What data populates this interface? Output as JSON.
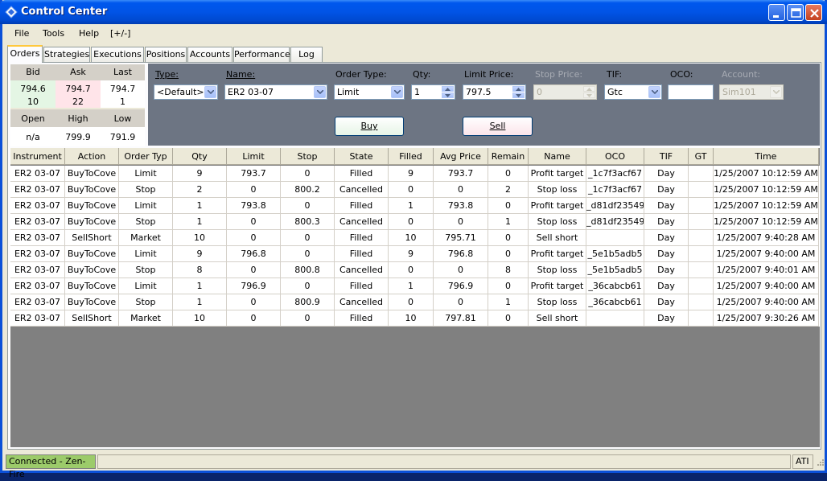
{
  "window": {
    "title": "Control Center"
  },
  "menu": {
    "file": "File",
    "tools": "Tools",
    "help": "Help",
    "toggle": "[+/-]"
  },
  "tabs": [
    "Orders",
    "Strategies",
    "Executions",
    "Positions",
    "Accounts",
    "Performance",
    "Log"
  ],
  "quote": {
    "bid_label": "Bid",
    "ask_label": "Ask",
    "last_label": "Last",
    "bid": "794.6",
    "ask": "794.7",
    "last": "794.7",
    "bid_size": "10",
    "ask_size": "22",
    "last_size": "1",
    "open_label": "Open",
    "high_label": "High",
    "low_label": "Low",
    "open": "n/a",
    "high": "799.9",
    "low": "791.9"
  },
  "entry": {
    "type_label": "Type:",
    "type_value": "<Default>",
    "name_label": "Name:",
    "name_value": "ER2 03-07",
    "order_type_label": "Order Type:",
    "order_type_value": "Limit",
    "qty_label": "Qty:",
    "qty_value": "1",
    "limit_label": "Limit Price:",
    "limit_value": "797.5",
    "stop_label": "Stop Price:",
    "stop_value": "0",
    "tif_label": "TIF:",
    "tif_value": "Gtc",
    "oco_label": "OCO:",
    "oco_value": "",
    "account_label": "Account:",
    "account_value": "Sim101",
    "buy_label": "Buy",
    "sell_label": "Sell"
  },
  "grid": {
    "columns": [
      "Instrument",
      "Action",
      "Order Typ",
      "Qty",
      "Limit",
      "Stop",
      "State",
      "Filled",
      "Avg Price",
      "Remain",
      "Name",
      "OCO",
      "TIF",
      "GT",
      "Time"
    ],
    "rows": [
      [
        "ER2 03-07",
        "BuyToCove",
        "Limit",
        "9",
        "793.7",
        "0",
        "Filled",
        "9",
        "793.7",
        "0",
        "Profit target",
        "_1c7f3acf67",
        "Day",
        "",
        "1/25/2007 10:12:59 AM"
      ],
      [
        "ER2 03-07",
        "BuyToCove",
        "Stop",
        "2",
        "0",
        "800.2",
        "Cancelled",
        "0",
        "0",
        "2",
        "Stop loss",
        "_1c7f3acf67",
        "Day",
        "",
        "1/25/2007 10:12:59 AM"
      ],
      [
        "ER2 03-07",
        "BuyToCove",
        "Limit",
        "1",
        "793.8",
        "0",
        "Filled",
        "1",
        "793.8",
        "0",
        "Profit target",
        "_d81df23549",
        "Day",
        "",
        "1/25/2007 10:12:59 AM"
      ],
      [
        "ER2 03-07",
        "BuyToCove",
        "Stop",
        "1",
        "0",
        "800.3",
        "Cancelled",
        "0",
        "0",
        "1",
        "Stop loss",
        "_d81df23549",
        "Day",
        "",
        "1/25/2007 10:12:59 AM"
      ],
      [
        "ER2 03-07",
        "SellShort",
        "Market",
        "10",
        "0",
        "0",
        "Filled",
        "10",
        "795.71",
        "0",
        "Sell short",
        "",
        "Day",
        "",
        "1/25/2007 9:40:28 AM"
      ],
      [
        "ER2 03-07",
        "BuyToCove",
        "Limit",
        "9",
        "796.8",
        "0",
        "Filled",
        "9",
        "796.8",
        "0",
        "Profit target",
        "_5e1b5adb5",
        "Day",
        "",
        "1/25/2007 9:40:00 AM"
      ],
      [
        "ER2 03-07",
        "BuyToCove",
        "Stop",
        "8",
        "0",
        "800.8",
        "Cancelled",
        "0",
        "0",
        "8",
        "Stop loss",
        "_5e1b5adb5",
        "Day",
        "",
        "1/25/2007 9:40:01 AM"
      ],
      [
        "ER2 03-07",
        "BuyToCove",
        "Limit",
        "1",
        "796.9",
        "0",
        "Filled",
        "1",
        "796.9",
        "0",
        "Profit target",
        "_36cabcb61",
        "Day",
        "",
        "1/25/2007 9:40:00 AM"
      ],
      [
        "ER2 03-07",
        "BuyToCove",
        "Stop",
        "1",
        "0",
        "800.9",
        "Cancelled",
        "0",
        "0",
        "1",
        "Stop loss",
        "_36cabcb61",
        "Day",
        "",
        "1/25/2007 9:40:00 AM"
      ],
      [
        "ER2 03-07",
        "SellShort",
        "Market",
        "10",
        "0",
        "0",
        "Filled",
        "10",
        "797.81",
        "0",
        "Sell short",
        "",
        "Day",
        "",
        "1/25/2007 9:30:26 AM"
      ]
    ]
  },
  "status": {
    "connection": "Connected - Zen-Fire",
    "right": "ATI"
  },
  "colors": {
    "title_blue": "#0054E3",
    "ask_highlight": "#FFE4E9",
    "bid_highlight": "#E4F6E4",
    "connected_green": "#9CCB6A",
    "entry_bg": "#6D7583"
  }
}
